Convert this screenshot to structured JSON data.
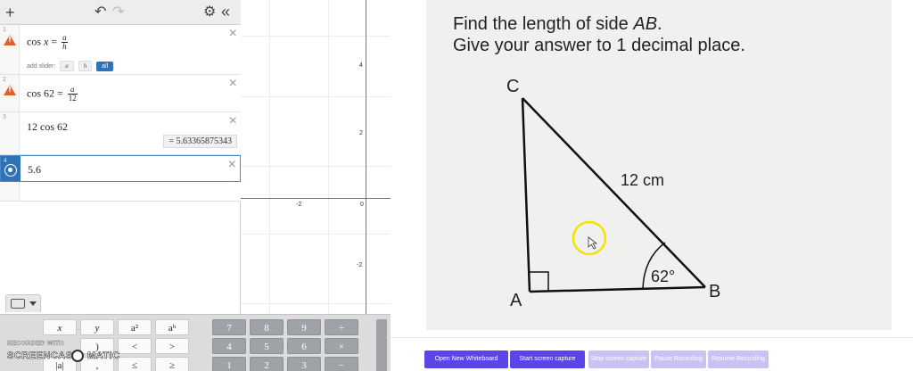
{
  "toolbar": {
    "add": "+",
    "undo": "↶",
    "redo": "↷",
    "settings": "⚙",
    "collapse": "«"
  },
  "expressions": [
    {
      "index": "1",
      "lhs": "cos",
      "var": "x",
      "num": "a",
      "den": "h"
    },
    {
      "index": "2",
      "lhs": "cos 62 =",
      "num": "a",
      "den": "12"
    },
    {
      "index": "3",
      "text": "12 cos 62",
      "result": "= 5.63365875343"
    },
    {
      "index": "4",
      "text": "5.6"
    }
  ],
  "sliders": {
    "label": "add slider:",
    "a": "a",
    "h": "h",
    "all": "all"
  },
  "graph": {
    "ticks_y": [
      "4",
      "2",
      "-2"
    ],
    "ticks_x": [
      "-2",
      "0"
    ]
  },
  "keypad": {
    "toggle_icon": "keyboard-icon",
    "row1": [
      "x",
      "y",
      "a²",
      "aᵇ",
      "7",
      "8",
      "9",
      "÷"
    ],
    "row2": [
      "(",
      ")",
      "<",
      ">",
      "4",
      "5",
      "6",
      "×"
    ],
    "row3": [
      "|a|",
      ",",
      "≤",
      "≥",
      "1",
      "2",
      "3",
      "−"
    ]
  },
  "watermark": {
    "top": "RECORDED WITH",
    "left": "SCREENCAST",
    "right": "MATIC"
  },
  "photo": {
    "line1_a": "Find the length of side ",
    "line1_b": "AB",
    "line1_c": ".",
    "line2": "Give your answer to 1 decimal place.",
    "vertex_c": "C",
    "vertex_a": "A",
    "vertex_b": "B",
    "hyp": "12 cm",
    "angle": "62°"
  },
  "bottom": {
    "open_whiteboard": "Open New Whiteboard",
    "start_capture": "Start screen capture",
    "stop_capture": "Stop screen capture",
    "pause": "Pause Recording",
    "resume": "Resume Recording"
  },
  "colors": {
    "accent": "#5b45e6",
    "desmos_blue": "#2f72b8",
    "warning": "#e0602e",
    "cursor_ring": "#f2e300"
  }
}
